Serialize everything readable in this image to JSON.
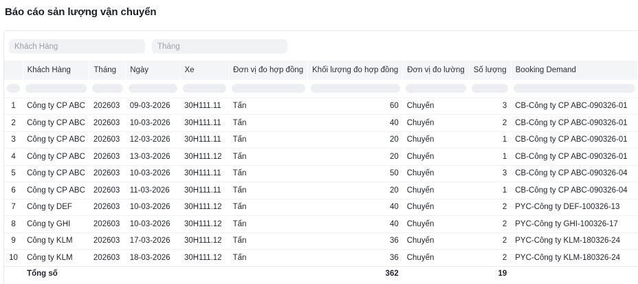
{
  "page": {
    "title": "Báo cáo sản lượng vận chuyển"
  },
  "filters": {
    "customer_placeholder": "Khách Hàng",
    "month_placeholder": "Tháng"
  },
  "table": {
    "columns": [
      "",
      "Khách Hàng",
      "Tháng",
      "Ngày",
      "Xe",
      "Đơn vị đo hợp đồng",
      "Khối lượng đo hợp đồng",
      "Đơn vị đo lường",
      "Số lượng",
      "Booking Demand"
    ],
    "rows": [
      [
        "1",
        "Công ty CP ABC",
        "202603",
        "09-03-2026",
        "30H111.11",
        "Tấn",
        "60",
        "Chuyến",
        "3",
        "CB-Công ty CP ABC-090326-01"
      ],
      [
        "2",
        "Công ty CP ABC",
        "202603",
        "10-03-2026",
        "30H111.11",
        "Tấn",
        "40",
        "Chuyến",
        "2",
        "CB-Công ty CP ABC-090326-01"
      ],
      [
        "3",
        "Công ty CP ABC",
        "202603",
        "12-03-2026",
        "30H111.11",
        "Tấn",
        "20",
        "Chuyến",
        "1",
        "CB-Công ty CP ABC-090326-01"
      ],
      [
        "4",
        "Công ty CP ABC",
        "202603",
        "13-03-2026",
        "30H111.12",
        "Tấn",
        "20",
        "Chuyến",
        "1",
        "CB-Công ty CP ABC-090326-01"
      ],
      [
        "5",
        "Công ty CP ABC",
        "202603",
        "10-03-2026",
        "30H111.11",
        "Tấn",
        "50",
        "Chuyến",
        "3",
        "CB-Công ty CP ABC-090326-04"
      ],
      [
        "6",
        "Công ty CP ABC",
        "202603",
        "11-03-2026",
        "30H111.11",
        "Tấn",
        "20",
        "Chuyến",
        "1",
        "CB-Công ty CP ABC-090326-04"
      ],
      [
        "7",
        "Công ty DEF",
        "202603",
        "10-03-2026",
        "30H111.12",
        "Tấn",
        "40",
        "Chuyến",
        "2",
        "PYC-Công ty DEF-100326-13"
      ],
      [
        "8",
        "Công ty GHI",
        "202603",
        "10-03-2026",
        "30H111.12",
        "Tấn",
        "40",
        "Chuyến",
        "2",
        "PYC-Công ty GHI-100326-17"
      ],
      [
        "9",
        "Công ty KLM",
        "202603",
        "17-03-2026",
        "30H111.12",
        "Tấn",
        "36",
        "Chuyến",
        "2",
        "PYC-Công ty KLM-180326-24"
      ],
      [
        "10",
        "Công ty KLM",
        "202603",
        "18-03-2026",
        "30H111.12",
        "Tấn",
        "36",
        "Chuyến",
        "2",
        "PYC-Công ty KLM-180326-24"
      ]
    ],
    "footer": {
      "label": "Tổng số",
      "total_weight": "362",
      "total_quantity": "19"
    }
  }
}
